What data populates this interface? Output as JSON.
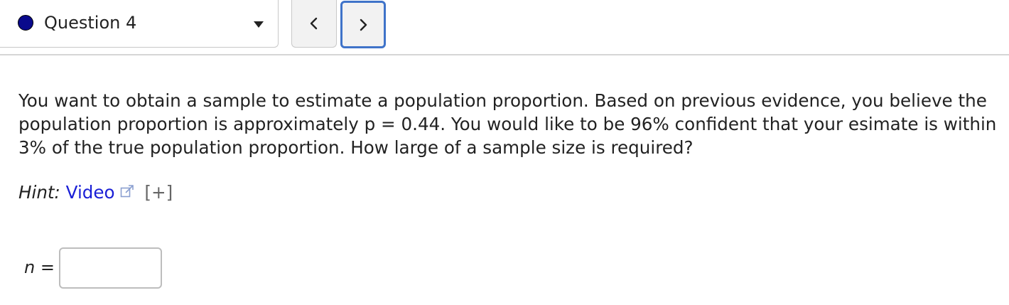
{
  "colors": {
    "status_dot": "#0a0a8c",
    "link": "#1a1fd6",
    "focus_border": "#3f73c9"
  },
  "question_selector": {
    "label": "Question 4",
    "status_icon": "filled-circle-icon",
    "dropdown_icon": "caret-down-icon"
  },
  "navigation": {
    "prev_icon": "chevron-left-icon",
    "next_icon": "chevron-right-icon"
  },
  "question": {
    "text": "You want to obtain a sample to estimate a population proportion. Based on previous evidence, you believe the population proportion is approximately p = 0.44. You would like to be 96% confident that your esimate is within 3% of the true population proportion. How large of a sample size is required?"
  },
  "hint": {
    "label": "Hint:",
    "link_text": "Video",
    "link_icon": "external-link-icon",
    "expand_text": "[+]"
  },
  "answer": {
    "variable": "n",
    "equals": "=",
    "value": ""
  }
}
